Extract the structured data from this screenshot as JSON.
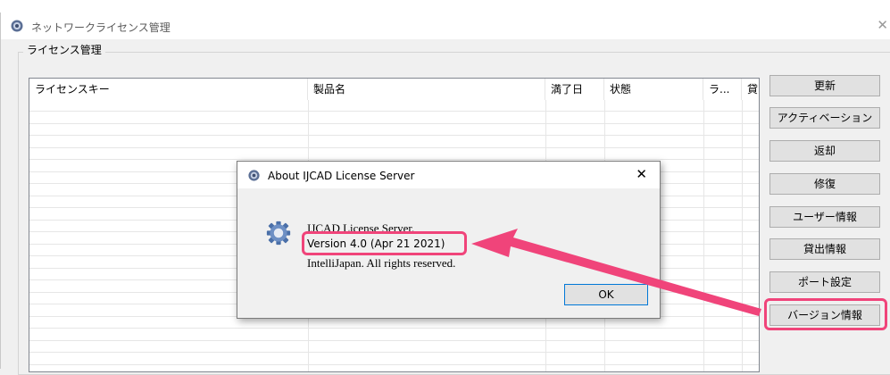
{
  "window": {
    "title": "ネットワークライセンス管理",
    "close_glyph": "✕"
  },
  "group": {
    "label": "ライセンス管理"
  },
  "table": {
    "columns": [
      "ライセンスキー",
      "製品名",
      "満了日",
      "状態",
      "ラ...",
      "貸"
    ],
    "rows": []
  },
  "buttons": {
    "update": "更新",
    "activate": "アクティベーション",
    "return": "返却",
    "repair": "修復",
    "user_info": "ユーザー情報",
    "lend_info": "貸出情報",
    "port_settings": "ポート設定",
    "version_info": "バージョン情報"
  },
  "about_dialog": {
    "title": "About IJCAD License Server",
    "close_glyph": "✕",
    "product": "IJCAD License Server.",
    "version": "Version 4.0 (Apr 21 2021)",
    "copyright": "IntelliJapan. All rights reserved.",
    "ok": "OK"
  },
  "annotation": {
    "highlight_color": "#f0447a",
    "arrow_icon": "arrow-icon"
  }
}
